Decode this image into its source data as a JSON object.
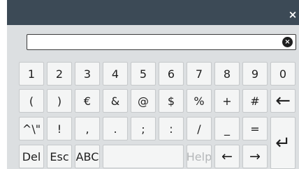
{
  "title_bar": {
    "close_label": "×"
  },
  "input": {
    "value": "",
    "clear_label": "×"
  },
  "rows": [
    [
      "1",
      "2",
      "3",
      "4",
      "5",
      "6",
      "7",
      "8",
      "9",
      "0"
    ],
    [
      "(",
      ")",
      "€",
      "&",
      "@",
      "$",
      "%",
      "+",
      "#",
      "←"
    ],
    [
      "^\\\"",
      "!",
      ",",
      ".",
      ";",
      ":",
      "/",
      "_",
      "=",
      "↵"
    ],
    [
      "Del",
      "Esc",
      "ABC",
      "",
      "Help",
      "←",
      "→"
    ]
  ],
  "disabled_keys": [
    "Help"
  ]
}
